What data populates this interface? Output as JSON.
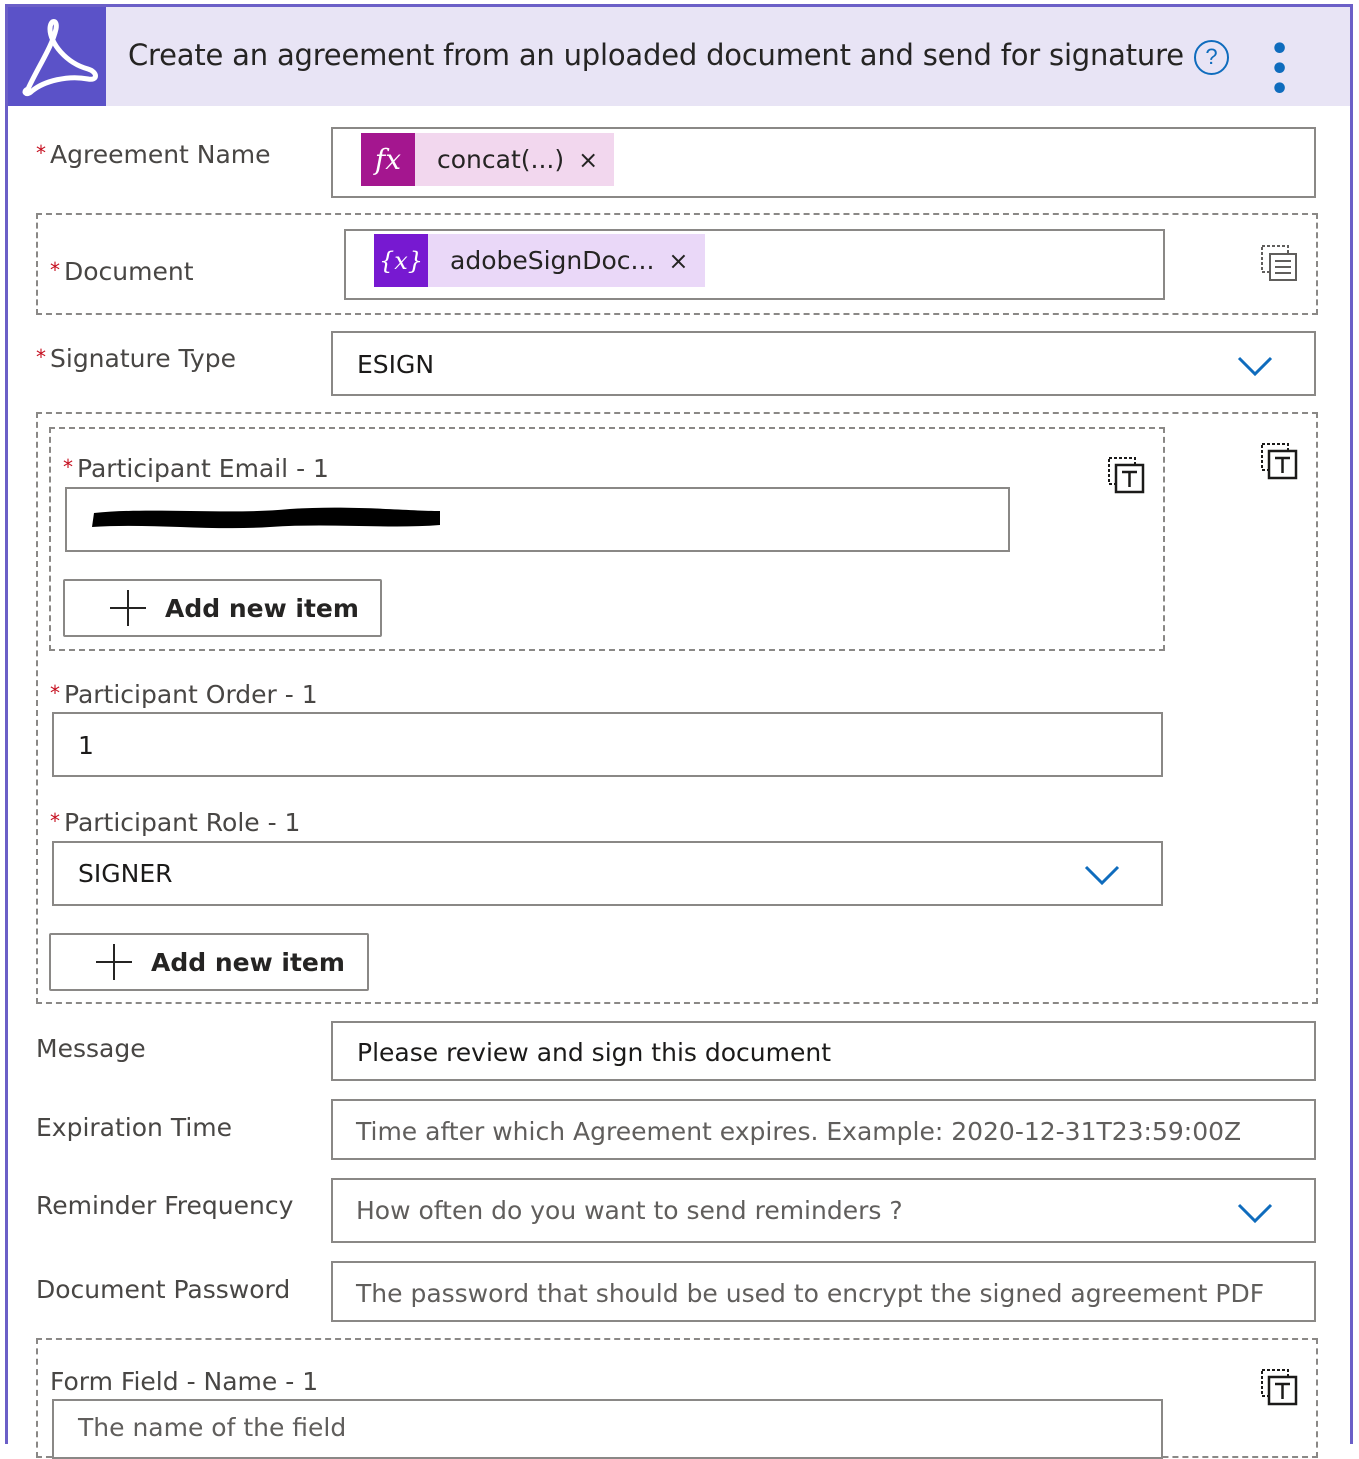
{
  "header": {
    "title": "Create an agreement from an uploaded document and send for signature",
    "help_symbol": "?",
    "more_symbol": "• • •"
  },
  "fields": {
    "agreement_name": {
      "label": "Agreement Name",
      "token_label": "concat(...)",
      "token_icon": "fx-function-icon",
      "token_color": "#a4168f"
    },
    "document": {
      "label": "Document",
      "token_label": "adobeSignDoc...",
      "token_icon": "variable-icon",
      "token_color": "#7719d1"
    },
    "signature_type": {
      "label": "Signature Type",
      "value": "ESIGN"
    },
    "participant_email": {
      "label": "Participant Email - 1",
      "value": ""
    },
    "participant_order": {
      "label": "Participant Order - 1",
      "value": "1"
    },
    "participant_role": {
      "label": "Participant Role - 1",
      "value": "SIGNER"
    },
    "message": {
      "label": "Message",
      "value": "Please review and sign this document"
    },
    "expiration_time": {
      "label": "Expiration Time",
      "placeholder": "Time after which Agreement expires. Example: 2020-12-31T23:59:00Z"
    },
    "reminder_frequency": {
      "label": "Reminder Frequency",
      "placeholder": "How often do you want to send reminders ?"
    },
    "document_password": {
      "label": "Document Password",
      "placeholder": "The password that should be used to encrypt the signed agreement PDF"
    },
    "form_field_name": {
      "label": "Form Field - Name - 1",
      "placeholder": "The name of the field"
    }
  },
  "buttons": {
    "add_new_item": "Add new item",
    "remove_token": "×"
  },
  "token_text": {
    "fx": "fx",
    "var": "{x}"
  },
  "colors": {
    "accent": "#0f6cbd",
    "header_bg": "#e8e4f5",
    "logo_bg": "#5b52c8",
    "required": "#c50f1f"
  }
}
